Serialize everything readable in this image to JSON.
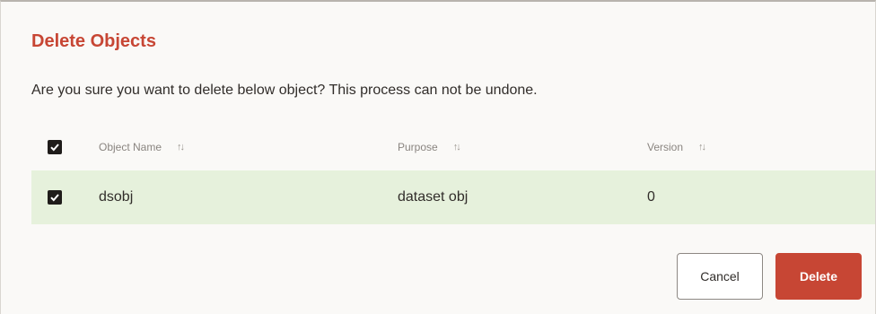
{
  "dialog": {
    "title": "Delete Objects",
    "message": "Are you sure you want to delete below object? This process can not be undone."
  },
  "table": {
    "header_checked": true,
    "columns": [
      "Object Name",
      "Purpose",
      "Version"
    ],
    "sort_icon": "sort-icon",
    "rows": [
      {
        "checked": true,
        "name": "dsobj",
        "purpose": "dataset obj",
        "version": "0"
      }
    ]
  },
  "buttons": {
    "cancel_label": "Cancel",
    "delete_label": "Delete"
  },
  "colors": {
    "accent": "#c74634",
    "selected_row": "#e6f1dc"
  }
}
